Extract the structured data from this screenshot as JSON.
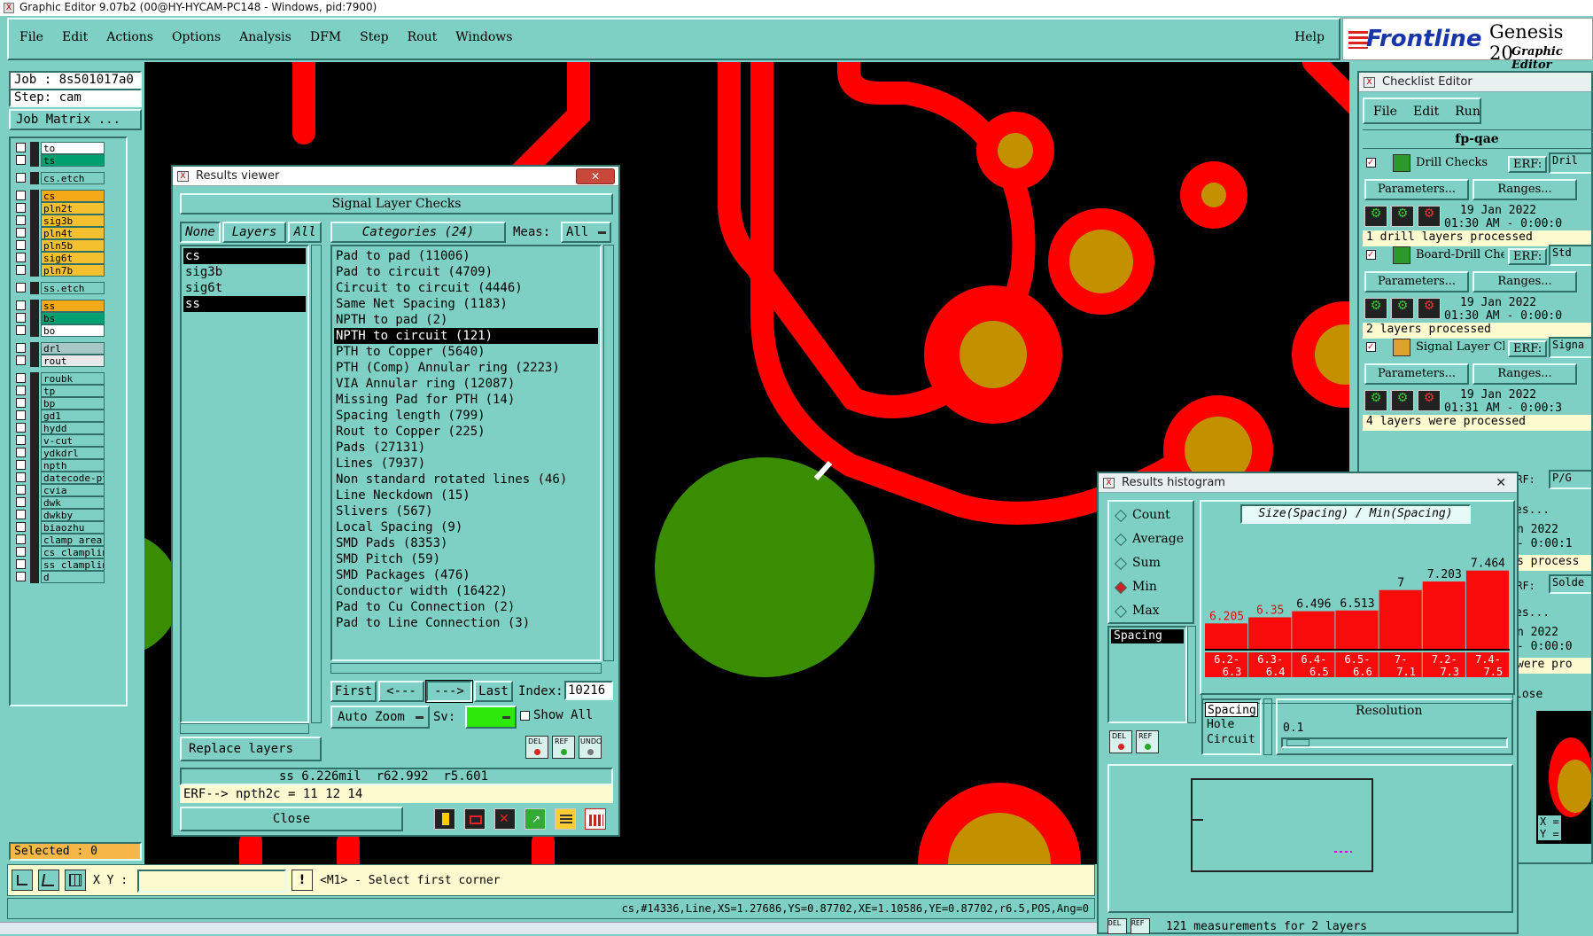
{
  "app": {
    "title": "Graphic Editor 9.07b2 (00@HY-HYCAM-PC148 - Windows, pid:7900)",
    "brand": "Frontline",
    "product": "Genesis 20",
    "product_sub": "Graphic Editor"
  },
  "menu": [
    "File",
    "Edit",
    "Actions",
    "Options",
    "Analysis",
    "DFM",
    "Step",
    "Rout",
    "Windows"
  ],
  "help": "Help",
  "job": {
    "job_label": "Job : 8s501017a0",
    "step_label": "Step: cam",
    "matrix_button": "Job Matrix ...",
    "selected": "Selected : 0"
  },
  "layers": [
    {
      "name": "to",
      "color": "#ffffff",
      "group": 1
    },
    {
      "name": "ts",
      "color": "#00a070",
      "group": 1
    },
    {
      "name": "cs.etch",
      "color": "#7ecfc4",
      "group": 2
    },
    {
      "name": "cs",
      "color": "#f5a818",
      "group": 3
    },
    {
      "name": "pln2t",
      "color": "#f5c030",
      "group": 3
    },
    {
      "name": "sig3b",
      "color": "#f5c030",
      "group": 3
    },
    {
      "name": "pln4t",
      "color": "#f5c030",
      "group": 3
    },
    {
      "name": "pln5b",
      "color": "#f5c030",
      "group": 3
    },
    {
      "name": "sig6t",
      "color": "#f5c030",
      "group": 3
    },
    {
      "name": "pln7b",
      "color": "#f5c030",
      "group": 3
    },
    {
      "name": "ss.etch",
      "color": "#7ecfc4",
      "group": 4
    },
    {
      "name": "ss",
      "color": "#f5a818",
      "group": 5
    },
    {
      "name": "bs",
      "color": "#00a070",
      "group": 5
    },
    {
      "name": "bo",
      "color": "#ffffff",
      "group": 5
    },
    {
      "name": "drl",
      "color": "#a8c8c8",
      "group": 6
    },
    {
      "name": "rout",
      "color": "#e8e8e8",
      "group": 6
    },
    {
      "name": "roubk",
      "color": "#7ecfc4",
      "group": 7
    },
    {
      "name": "tp",
      "color": "#7ecfc4",
      "group": 7
    },
    {
      "name": "bp",
      "color": "#7ecfc4",
      "group": 7
    },
    {
      "name": "gd1",
      "color": "#7ecfc4",
      "group": 7
    },
    {
      "name": "hydd",
      "color": "#7ecfc4",
      "group": 7
    },
    {
      "name": "v-cut",
      "color": "#7ecfc4",
      "group": 7
    },
    {
      "name": "ydkdrl",
      "color": "#7ecfc4",
      "group": 7
    },
    {
      "name": "npth",
      "color": "#7ecfc4",
      "group": 7
    },
    {
      "name": "datecode-pt",
      "color": "#7ecfc4",
      "group": 7
    },
    {
      "name": "cvia",
      "color": "#7ecfc4",
      "group": 7
    },
    {
      "name": "dwk",
      "color": "#7ecfc4",
      "group": 7
    },
    {
      "name": "dwkby",
      "color": "#7ecfc4",
      "group": 7
    },
    {
      "name": "biaozhu",
      "color": "#7ecfc4",
      "group": 7
    },
    {
      "name": "clamp_area",
      "color": "#7ecfc4",
      "group": 7
    },
    {
      "name": "cs_clamplin",
      "color": "#7ecfc4",
      "group": 7
    },
    {
      "name": "ss_clamplin",
      "color": "#7ecfc4",
      "group": 7
    },
    {
      "name": "d",
      "color": "#7ecfc4",
      "group": 7
    }
  ],
  "results_viewer": {
    "title": "Results viewer",
    "header": "Signal Layer Checks",
    "none_btn": "None",
    "layers_btn": "Layers",
    "all_btn": "All",
    "categories_btn": "Categories (24)",
    "meas_label": "Meas:",
    "meas_value": "All",
    "layer_items": [
      "cs",
      "sig3b",
      "sig6t",
      "ss"
    ],
    "categories": [
      "Pad to pad (11006)",
      "Pad to circuit (4709)",
      "Circuit to circuit (4446)",
      "Same Net Spacing (1183)",
      "NPTH to pad (2)",
      "NPTH to circuit (121)",
      "PTH to Copper (5640)",
      "PTH (Comp) Annular ring (2223)",
      "VIA Annular ring (12087)",
      "Missing Pad for PTH (14)",
      "Spacing length (799)",
      "Rout to Copper (225)",
      "Pads (27131)",
      "Lines (7937)",
      "Non standard rotated lines (46)",
      "Line Neckdown (15)",
      "Slivers (567)",
      "Local Spacing (9)",
      "SMD Pads (8353)",
      "SMD Pitch (59)",
      "SMD Packages (476)",
      "Conductor width (16422)",
      "Pad to Cu Connection (2)",
      "Pad to Line Connection (3)"
    ],
    "first_btn": "First",
    "prev_btn": "<---",
    "next_btn": "--->",
    "last_btn": "Last",
    "index_label": "Index:",
    "index_value": "10216",
    "autozoom_btn": "Auto Zoom",
    "sv_label": "Sv:",
    "show_all": "Show All",
    "replace_btn": "Replace layers",
    "del_btn": "DEL",
    "ref_btn": "REF",
    "undo_btn": "UNDO",
    "measure": "ss 6.226mil  r62.992  r5.601",
    "erf": "ERF--> npth2c = 11 12 14",
    "close_btn": "Close"
  },
  "checklist": {
    "title": "Checklist Editor",
    "menu": [
      "File",
      "Edit",
      "Run"
    ],
    "name": "fp-qae",
    "items": [
      {
        "name": "Drill Checks",
        "erf": "ERF:",
        "erf_val": "Dril",
        "date": "19 Jan 2022",
        "time": "01:30 AM - 0:00:0",
        "status": "1 drill layers processed"
      },
      {
        "name": "Board-Drill Che",
        "erf": "ERF:",
        "erf_val": "Std",
        "date": "19 Jan 2022",
        "time": "01:30 AM - 0:00:0",
        "status": "2 layers processed"
      },
      {
        "name": "Signal Layer Ch",
        "erf": "ERF:",
        "erf_val": "Signa",
        "date": "19 Jan 2022",
        "time": "01:31 AM - 0:00:3",
        "status": "4 layers were processed"
      }
    ],
    "params_btn": "Parameters...",
    "ranges_btn": "Ranges...",
    "erf4": "ERF:",
    "erf4_val": "P/G",
    "erf5": "ERF:",
    "erf5_val": "Solde",
    "partial": [
      "es...",
      "n 2022",
      "- 0:00:1",
      "s process",
      "es...",
      "n 2022",
      "- 0:00:0",
      "were pro",
      "lose"
    ],
    "xy": [
      "X =",
      "Y ="
    ]
  },
  "histogram": {
    "title": "Results histogram",
    "modes": [
      "Count",
      "Average",
      "Sum",
      "Min",
      "Max"
    ],
    "selected_mode": "Min",
    "list_item": "Spacing",
    "chart_title": "Size(Spacing) / Min(Spacing)",
    "bins": [
      {
        "label_top": "6.2-",
        "label_bot": "6.3",
        "value": 6.205,
        "red": true
      },
      {
        "label_top": "6.3-",
        "label_bot": "6.4",
        "value": 6.35,
        "red": true
      },
      {
        "label_top": "6.4-",
        "label_bot": "6.5",
        "value": 6.496,
        "red": false
      },
      {
        "label_top": "6.5-",
        "label_bot": "6.6",
        "value": 6.513,
        "red": false
      },
      {
        "label_top": "7-",
        "label_bot": "7.1",
        "value": 7,
        "red": false
      },
      {
        "label_top": "7.2-",
        "label_bot": "7.3",
        "value": 7.203,
        "red": false
      },
      {
        "label_top": "7.4-",
        "label_bot": "7.5",
        "value": 7.464,
        "red": false
      }
    ],
    "value_labels": [
      "6.205",
      "6.35",
      "6.496",
      "6.513",
      "7",
      "7.203",
      "7.464"
    ],
    "types": [
      "Spacing",
      "Hole",
      "Circuit"
    ],
    "resolution_label": "Resolution",
    "resolution_value": "0.1",
    "del_btn": "DEL",
    "ref_btn": "REF",
    "footer": "121 measurements for 2 layers"
  },
  "bottom": {
    "xy_label": "X Y :",
    "prompt": "<M1> - Select first corner",
    "status": "cs,#14336,Line,XS=1.27686,YS=0.87702,XE=1.10586,YE=0.87702,r6.5,POS,Ang=0"
  }
}
